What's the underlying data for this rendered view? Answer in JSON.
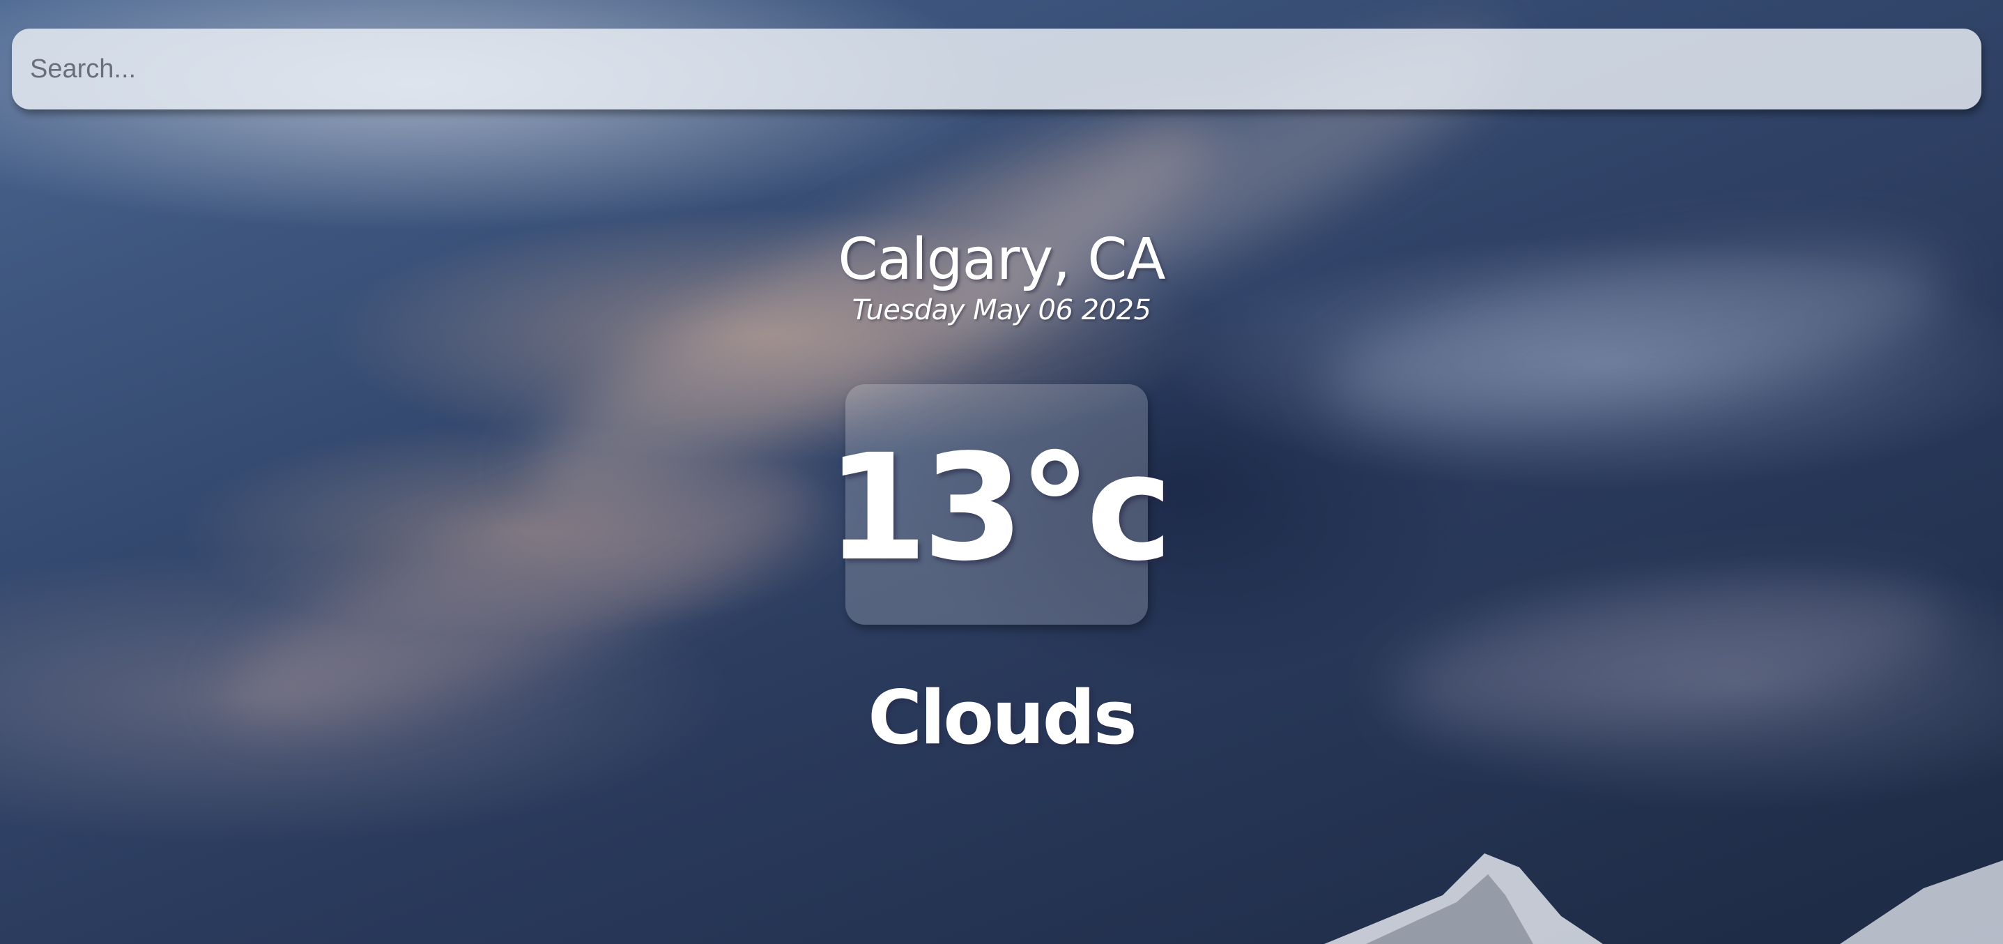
{
  "search": {
    "placeholder": "Search...",
    "value": ""
  },
  "location": {
    "city": "Calgary, CA",
    "date": "Tuesday May 06 2025"
  },
  "weather": {
    "temperature": "13°c",
    "condition": "Clouds"
  },
  "colors": {
    "text": "#ffffff",
    "search_bg": "#ecf0f6",
    "sky_dark": "#1d2a44",
    "sky_mid": "#34496f"
  }
}
